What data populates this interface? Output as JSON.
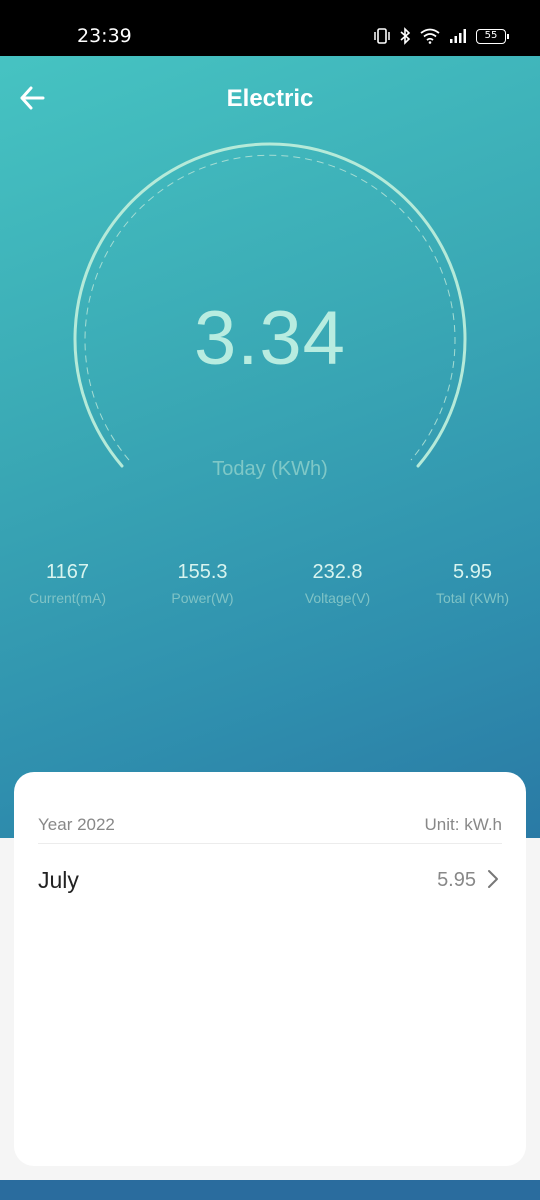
{
  "status_bar": {
    "time": "23:39",
    "battery": "55",
    "icons": [
      "vibrate-icon",
      "bluetooth-icon",
      "wifi-icon",
      "signal-icon",
      "battery-icon"
    ]
  },
  "header": {
    "title": "Electric",
    "back_icon": "arrow-left-icon"
  },
  "gauge": {
    "value": "3.34",
    "label": "Today (KWh)"
  },
  "stats": [
    {
      "value": "1167",
      "label": "Current(mA)"
    },
    {
      "value": "155.3",
      "label": "Power(W)"
    },
    {
      "value": "232.8",
      "label": "Voltage(V)"
    },
    {
      "value": "5.95",
      "label": "Total (KWh)"
    }
  ],
  "history": {
    "year_label": "Year 2022",
    "unit_label": "Unit: kW.h",
    "rows": [
      {
        "month": "July",
        "value": "5.95"
      }
    ]
  },
  "colors": {
    "gradient_start": "#46c3c2",
    "gradient_end": "#2a7aa5",
    "gauge_text": "#b8ece0",
    "card_bg": "#ffffff"
  }
}
